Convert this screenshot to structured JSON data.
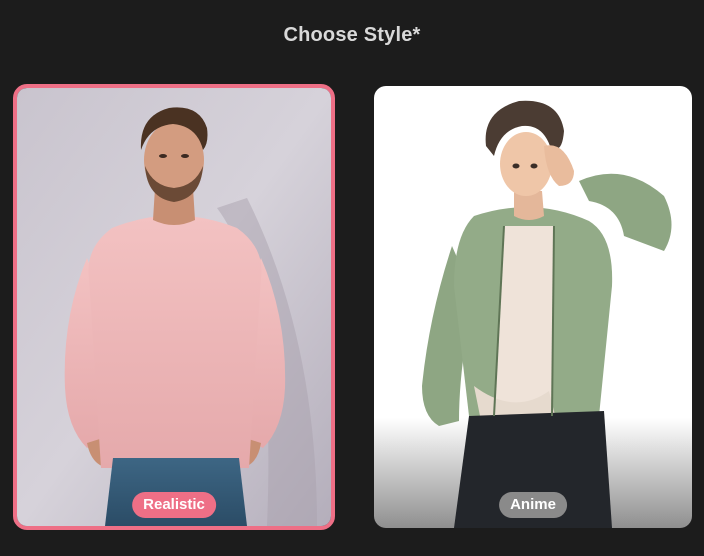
{
  "section": {
    "title": "Choose Style*"
  },
  "styles": [
    {
      "label": "Realistic",
      "selected": true,
      "accent_color": "#ee6f86",
      "image": "realistic-man-pink-sweater"
    },
    {
      "label": "Anime",
      "selected": false,
      "accent_color": "#8a8a8a",
      "image": "anime-boy-green-shirt"
    }
  ],
  "colors": {
    "background": "#1c1c1c",
    "selected_border": "#ee6f86"
  }
}
